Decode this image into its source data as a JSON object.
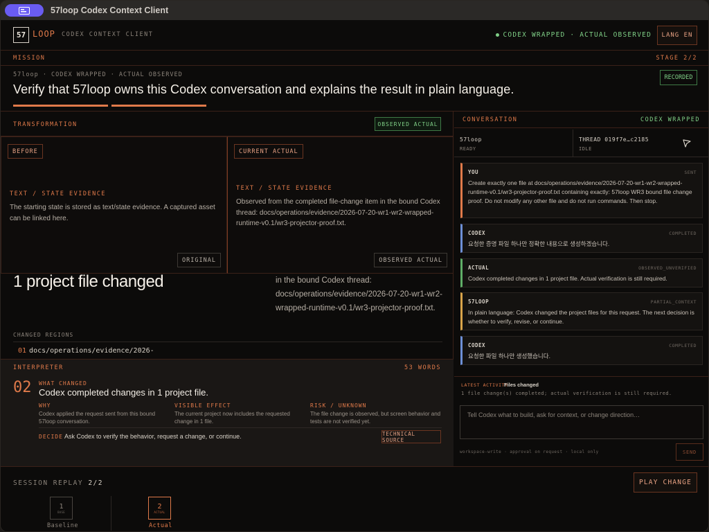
{
  "window": {
    "title": "57loop Codex Context Client"
  },
  "header": {
    "logo_mark": "57",
    "logo_word": "LOOP",
    "logo_sub": "CODEX CONTEXT CLIENT",
    "status": "CODEX WRAPPED · ACTUAL OBSERVED",
    "lang_button": "LANG EN"
  },
  "mission": {
    "label": "MISSION",
    "stage": "STAGE 2/2",
    "sub": "57loop · CODEX WRAPPED · ACTUAL OBSERVED",
    "title": "Verify that 57loop owns this Codex conversation and explains the result in plain language.",
    "badge": "RECORDED"
  },
  "transformation": {
    "label": "TRANSFORMATION",
    "badge": "OBSERVED ACTUAL",
    "before": {
      "tag": "BEFORE",
      "kind": "TEXT / STATE EVIDENCE",
      "text": "The starting state is stored as text/state evidence. A captured asset can be linked here.",
      "footer": "ORIGINAL"
    },
    "current": {
      "tag": "CURRENT ACTUAL",
      "kind": "TEXT / STATE EVIDENCE",
      "text": "Observed from the completed file-change item in the bound Codex thread: docs/operations/evidence/2026-07-20-wr1-wr2-wrapped-runtime-v0.1/wr3-projector-proof.txt.",
      "footer": "OBSERVED ACTUAL"
    }
  },
  "result": {
    "title": "1 project file changed",
    "side_text": "in the bound Codex thread: docs/operations/evidence/2026-07-20-wr1-wr2-wrapped-runtime-v0.1/wr3-projector-proof.txt.",
    "changed_label": "CHANGED REGIONS",
    "changed_num": "01",
    "changed_path": "docs/operations/evidence/2026-"
  },
  "interpreter": {
    "label": "INTERPRETER",
    "words": "53 WORDS",
    "number": "02",
    "what_label": "WHAT CHANGED",
    "headline": "Codex completed changes in 1 project file.",
    "why": {
      "h": "WHY",
      "t": "Codex applied the request sent from this bound 57loop conversation."
    },
    "visible": {
      "h": "VISIBLE EFFECT",
      "t": "The current project now includes the requested change in 1 file."
    },
    "risk": {
      "h": "RISK / UNKNOWN",
      "t": "The file change is observed, but screen behavior and tests are not verified yet."
    },
    "decide_label": "DECIDE",
    "decide_text": "Ask Codex to verify the behavior, request a change, or continue.",
    "tech_button": "TECHNICAL SOURCE"
  },
  "conversation": {
    "label": "CONVERSATION",
    "status": "CODEX WRAPPED",
    "thread_a": {
      "name": "57loop",
      "state": "READY"
    },
    "thread_b": {
      "name": "THREAD 019f7e…c2185",
      "state": "IDLE"
    },
    "messages": [
      {
        "who": "YOU",
        "state": "SENT",
        "body": "Create exactly one file at docs/operations/evidence/2026-07-20-wr1-wr2-wrapped-runtime-v0.1/wr3-projector-proof.txt containing exactly: 57loop WR3 bound file change proof. Do not modify any other file and do not run commands. Then stop."
      },
      {
        "who": "CODEX",
        "state": "COMPLETED",
        "body": "요청한 증명 파일 하나만 정확한 내용으로 생성하겠습니다."
      },
      {
        "who": "ACTUAL",
        "state": "OBSERVED_UNVERIFIED",
        "body": "Codex completed changes in 1 project file. Actual verification is still required."
      },
      {
        "who": "57LOOP",
        "state": "PARTIAL_CONTEXT",
        "body": "In plain language: Codex changed the project files for this request. The next decision is whether to verify, revise, or continue."
      },
      {
        "who": "CODEX",
        "state": "COMPLETED",
        "body": "요청한 파일 하나만 생성했습니다."
      }
    ],
    "latest_label": "LATEST ACTIVITY",
    "latest_title": "Files changed",
    "latest_text": "1 file change(s) completed; actual verification is still required.",
    "composer_placeholder": "Tell Codex what to build, ask for context, or change direction…",
    "footnote": "workspace-write · approval on request · local only",
    "send": "SEND"
  },
  "replay": {
    "label": "SESSION REPLAY",
    "count": "2/2",
    "play": "PLAY CHANGE",
    "steps": [
      {
        "n": "1",
        "small": "BASE",
        "label": "Baseline"
      },
      {
        "n": "2",
        "small": "ACTUAL",
        "label": "Actual"
      }
    ]
  },
  "colors": {
    "accent": "#e07a4a",
    "ok": "#7fcf86",
    "bg": "#0c0b0a"
  }
}
